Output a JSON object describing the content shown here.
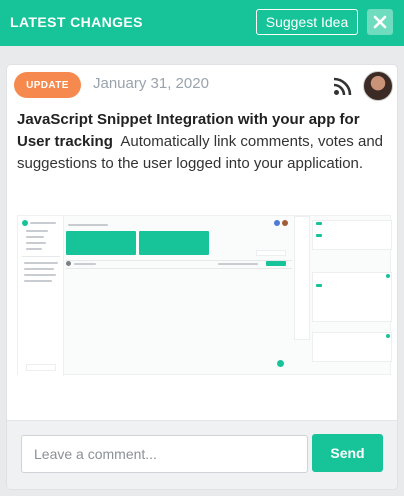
{
  "header": {
    "title": "LATEST CHANGES",
    "suggest_label": "Suggest Idea",
    "close_icon": "close-icon"
  },
  "post": {
    "badge": "UPDATE",
    "date": "January 31, 2020",
    "feed_icon": "rss-icon",
    "title": "JavaScript Snippet Integration with your app for User tracking",
    "body": "Automatically link comments, votes and suggestions to the user logged into your application."
  },
  "comment": {
    "placeholder": "Leave a comment...",
    "send_label": "Send"
  },
  "colors": {
    "accent": "#17c49a",
    "badge": "#f6894d"
  }
}
